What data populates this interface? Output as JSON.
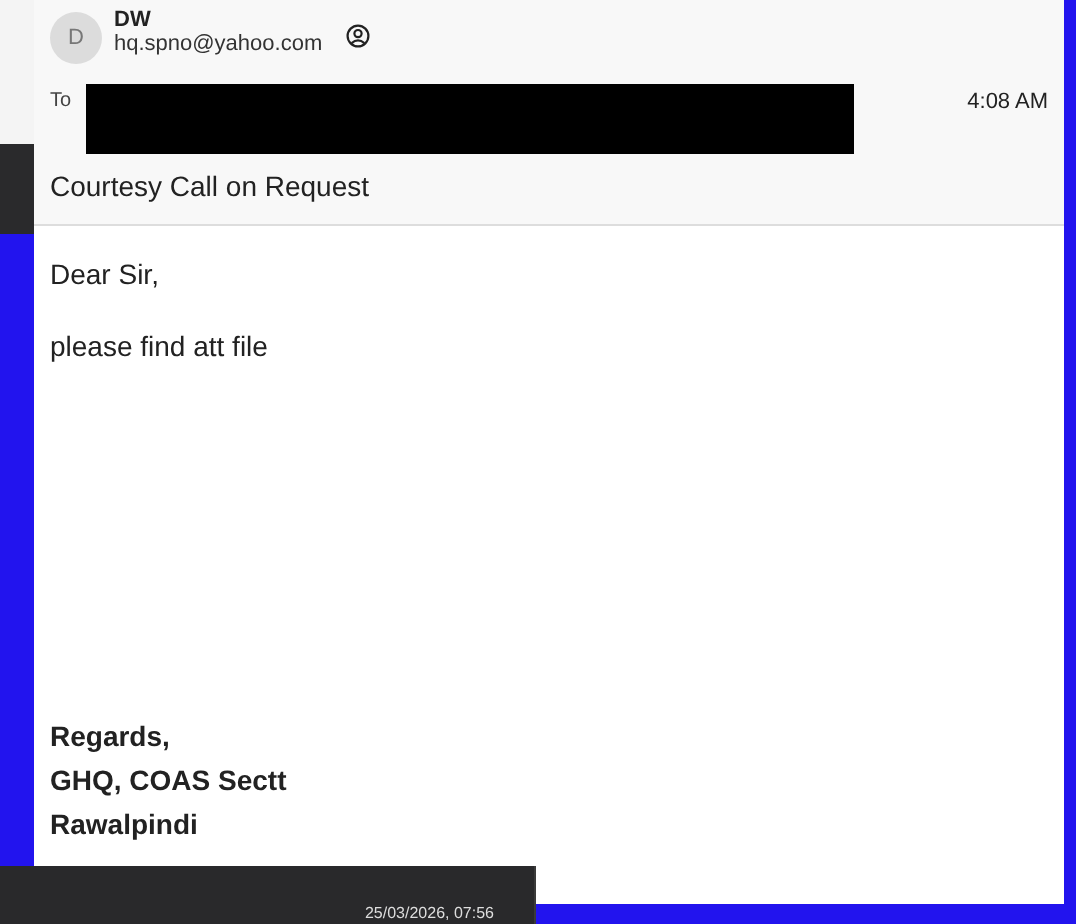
{
  "email": {
    "sender": {
      "initial": "D",
      "name": "DW",
      "address": "hq.spno@yahoo.com"
    },
    "to_label": "To",
    "time": "4:08 AM",
    "subject": "Courtesy Call on Request",
    "body": [
      "Dear Sir,",
      "please find att file"
    ],
    "signature": [
      "Regards,",
      "GHQ, COAS Sectt",
      "Rawalpindi"
    ]
  },
  "background_window": {
    "timestamp": "25/03/2026, 07:56"
  }
}
